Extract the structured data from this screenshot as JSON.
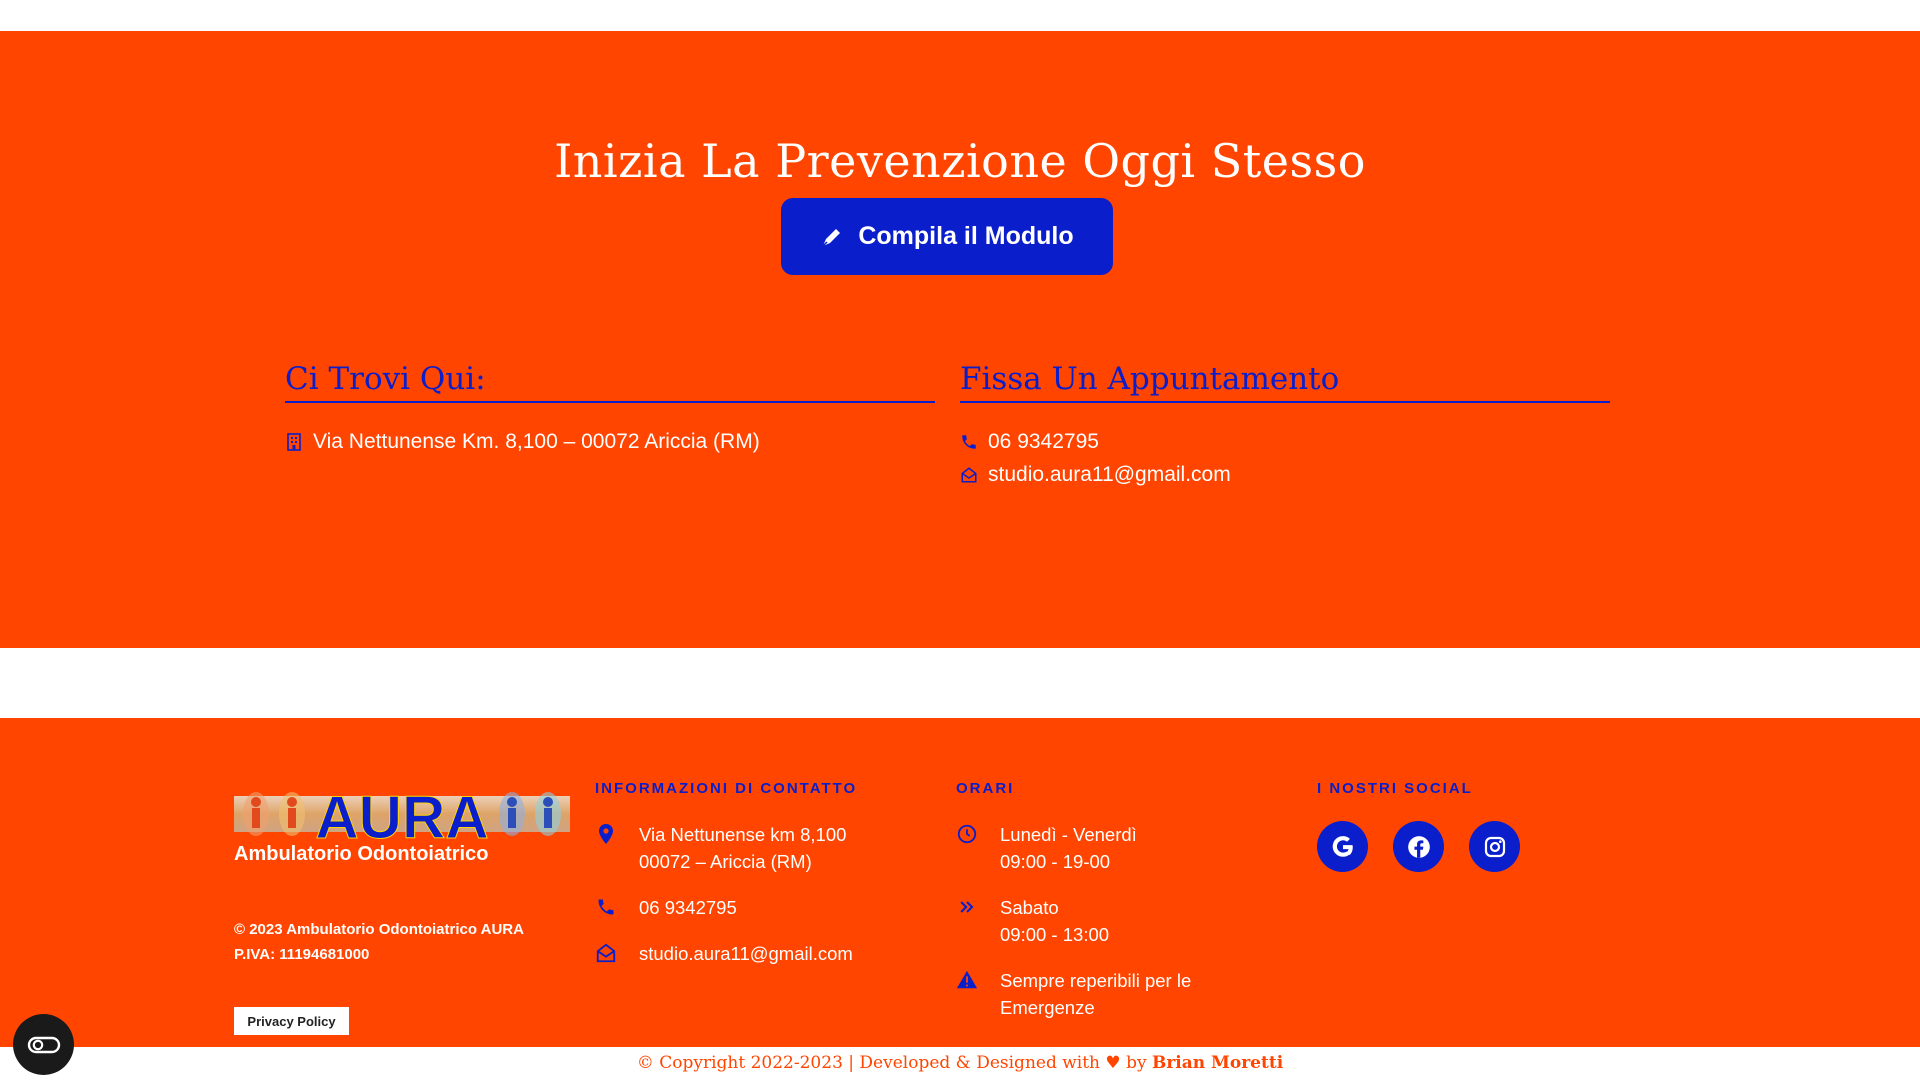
{
  "cta": {
    "title": "Inizia La Prevenzione Oggi Stesso",
    "button_label": "Compila il Modulo"
  },
  "locate": {
    "heading": "Ci Trovi Qui:",
    "address": "Via Nettunense Km. 8,100 – 00072 Ariccia (RM)"
  },
  "appointment": {
    "heading": "Fissa Un Appuntamento",
    "phone": "06 9342795",
    "email": "studio.aura11@gmail.com"
  },
  "footer": {
    "logo_text": "AURA",
    "logo_subtitle": "Ambulatorio Odontoiatrico",
    "copyright_line1": "© 2023 Ambulatorio Odontoiatrico AURA",
    "copyright_line2": "P.IVA: 11194681000",
    "privacy_label": "Privacy Policy",
    "contact": {
      "heading": "INFORMAZIONI DI CONTATTO",
      "address_line1": "Via Nettunense km 8,100",
      "address_line2": "00072 – Ariccia (RM)",
      "phone": "06 9342795",
      "email": "studio.aura11@gmail.com"
    },
    "hours": {
      "heading": "ORARI",
      "weekdays_label": "Lunedì - Venerdì",
      "weekdays_time": "09:00 - 19-00",
      "saturday_label": "Sabato",
      "saturday_time": "09:00 - 13:00",
      "emergency_line1": "Sempre reperibili per le",
      "emergency_line2": "Emergenze"
    },
    "social": {
      "heading": "I NOSTRI SOCIAL",
      "icons": [
        "google-icon",
        "facebook-icon",
        "instagram-icon"
      ]
    }
  },
  "bottom_bar": {
    "text": "Copyright 2022-2023 | Developed & Designed with",
    "by": "by",
    "author": "Brian Moretti"
  },
  "colors": {
    "brand_orange": "#ff4500",
    "brand_blue": "#0a1ecb",
    "white": "#ffffff"
  }
}
